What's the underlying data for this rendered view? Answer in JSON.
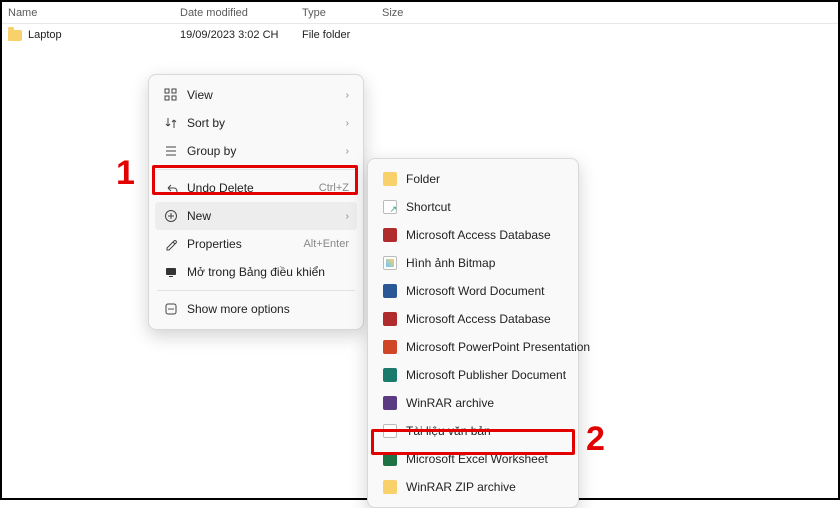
{
  "columns": {
    "name": "Name",
    "date": "Date modified",
    "type": "Type",
    "size": "Size"
  },
  "row": {
    "name": "Laptop",
    "date": "19/09/2023 3:02 CH",
    "type": "File folder"
  },
  "menu1": {
    "view": "View",
    "sort_by": "Sort by",
    "group_by": "Group by",
    "undo_delete": "Undo Delete",
    "undo_kb": "Ctrl+Z",
    "new": "New",
    "properties": "Properties",
    "properties_kb": "Alt+Enter",
    "open_cp": "Mở trong Bảng điều khiển",
    "show_more": "Show more options"
  },
  "menu2": {
    "folder": "Folder",
    "shortcut": "Shortcut",
    "access1": "Microsoft Access Database",
    "bitmap": "Hình ảnh Bitmap",
    "word": "Microsoft Word Document",
    "access2": "Microsoft Access Database",
    "ppt": "Microsoft PowerPoint Presentation",
    "pub": "Microsoft Publisher Document",
    "rar": "WinRAR archive",
    "txt": "Tài liệu văn bản",
    "excel": "Microsoft Excel Worksheet",
    "zip": "WinRAR ZIP archive"
  },
  "annotations": {
    "one": "1",
    "two": "2"
  }
}
